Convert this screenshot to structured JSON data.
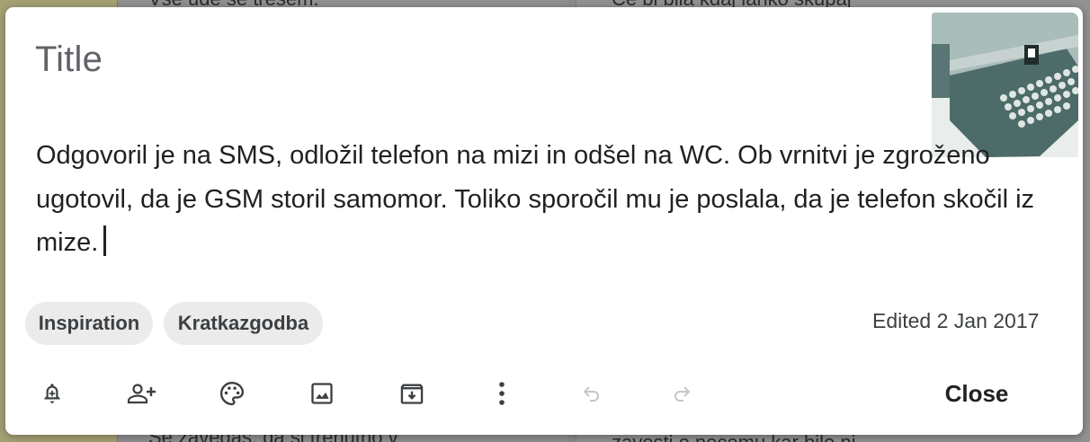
{
  "background": {
    "snippets": [
      "Vse ude se tresem.",
      "Ce bi bila kdaj lahko skupaj",
      "Se zavedas, da si trenutno v",
      "zavesti o necemu kar bilo ni"
    ]
  },
  "note": {
    "title_placeholder": "Title",
    "body": "Odgovoril je na SMS, odložil telefon na mizi in odšel na WC. Ob vrnitvi je zgroženo ugotovil, da je GSM storil samomor. Toliko sporočil mu je poslala, da je telefon skočil iz mize.",
    "labels": [
      "Inspiration",
      "Kratkazgodba"
    ],
    "edited": "Edited 2 Jan 2017",
    "image": "typewriter-photo"
  },
  "toolbar": {
    "icons": [
      "add-reminder-icon",
      "collaborator-icon",
      "palette-icon",
      "image-icon",
      "archive-icon",
      "more-vert-icon",
      "undo-icon",
      "redo-icon"
    ],
    "close_label": "Close"
  },
  "colors": {
    "text": "#202124",
    "muted": "#5f6368",
    "chip_bg": "#ebebeb",
    "disabled_icon": "#c4c7c5"
  }
}
